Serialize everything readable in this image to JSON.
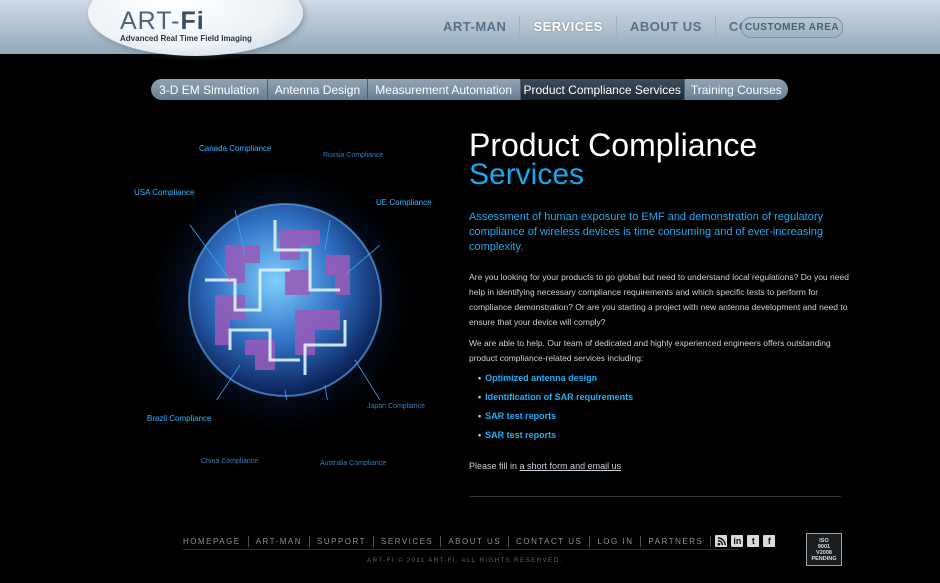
{
  "brand": {
    "name_part1": "ART-",
    "name_part2": "Fi",
    "tagline": "Advanced Real Time Field Imaging"
  },
  "topnav": {
    "items": [
      {
        "label": "ART-MAN",
        "active": false
      },
      {
        "label": "SERVICES",
        "active": true
      },
      {
        "label": "ABOUT US",
        "active": false
      },
      {
        "label": "CONTACT",
        "active": false
      }
    ],
    "customer_area": "CUSTOMER AREA"
  },
  "subtabs": [
    {
      "label": "3-D EM Simulation",
      "active": false
    },
    {
      "label": "Antenna Design",
      "active": false
    },
    {
      "label": "Measurement Automation",
      "active": false
    },
    {
      "label": "Product Compliance Services",
      "active": true
    },
    {
      "label": "Training Courses",
      "active": false
    }
  ],
  "globe_labels": {
    "canada": "Canada Compliance",
    "russia": "Russia Compliance",
    "usa": "USA Compliance",
    "ue": "UE Compliance",
    "brazil": "Brazil Compliance",
    "japan": "Japan Compliance",
    "china": "China Compliance",
    "australia": "Australia Compliance"
  },
  "content": {
    "title_line1": "Product Compliance",
    "title_line2": "Services",
    "lead": "Assessment of human exposure to EMF and demonstration of regulatory compliance of wireless devices is time consuming and of ever-increasing complexity.",
    "para1": "Are you looking for your products to go global but need to understand local regulations? Do you need help in identifying necessary compliance requirements and which specific tests to perform for compliance demonstration? Or are you starting a project with new antenna development and need to ensure that your device will comply?",
    "para2": "We are able to help. Our team of dedicated and highly experienced engineers offers outstanding product compliance-related services including:",
    "bullets": [
      "Optimized antenna design",
      "Identification of SAR requirements",
      "SAR test reports",
      "SAR test reports"
    ],
    "fill_prefix": "Please fill in",
    "fill_link": "a short form and email us"
  },
  "footer": {
    "nav": [
      "HOMEPAGE",
      "ART-MAN",
      "SUPPORT",
      "SERVICES",
      "ABOUT US",
      "CONTACT US",
      "LOG IN",
      "PARTNERS"
    ],
    "copyright": "ART-FI © 2011 ART-FI. ALL RIGHTS RESERVED.",
    "iso_badge": [
      "ISO",
      "9001",
      "V2008",
      "PENDING"
    ]
  },
  "colors": {
    "accent": "#19a8ee",
    "header": "#aebfcd",
    "background": "#000000"
  }
}
